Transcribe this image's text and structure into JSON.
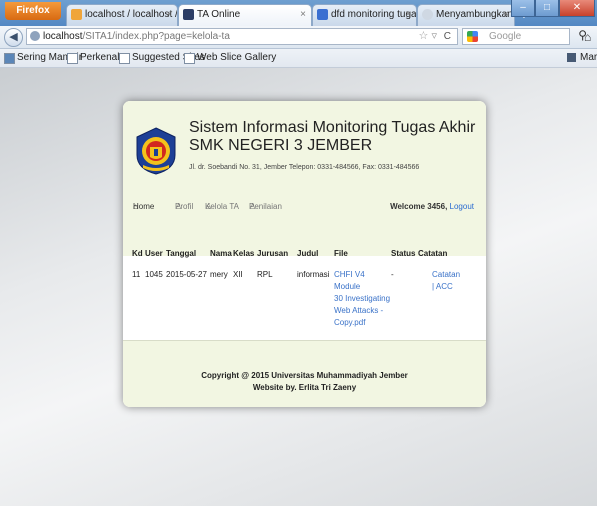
{
  "browser": {
    "firefox_button": "Firefox",
    "tabs": [
      {
        "label": "localhost / localhost / apli..."
      },
      {
        "label": "TA Online"
      },
      {
        "label": "dfd monitoring tugas akhi..."
      },
      {
        "label": "Menyambungkan..."
      }
    ],
    "url_host": "localhost",
    "url_path": "/SITA1/index.php?page=kelola-ta",
    "search_placeholder": "Google",
    "bookmarks": [
      "Sering Mampir",
      "Perkenalan",
      "Suggested Sites",
      "Web Slice Gallery"
    ],
    "bookmarks_right": "Markah"
  },
  "page": {
    "title_line1": "Sistem Informasi Monitoring Tugas Akhir",
    "title_line2": "SMK NEGERI 3 JEMBER",
    "address": "Jl. dr. Soebandi No. 31, Jember Telepon: 0331-484566, Fax: 0331-484566",
    "menu": {
      "home": "Home",
      "profil": "Profil",
      "kelola": "Kelola TA",
      "penilaian": "Penilaian"
    },
    "welcome": "Welcome 3456,",
    "logout": "Logout",
    "table": {
      "headers": [
        "Kd",
        "User",
        "Tanggal",
        "Nama",
        "Kelas",
        "Jurusan",
        "Judul",
        "File",
        "Status",
        "Catatan"
      ],
      "row": {
        "kd": "11",
        "user": "1045",
        "tanggal": "2015-05-27",
        "nama": "mery",
        "kelas": "XII",
        "jurusan": "RPL",
        "judul": "informasi",
        "file_lines": [
          "CHFI V4 Module",
          "30 Investigating",
          "Web Attacks -",
          "Copy.pdf"
        ],
        "status": "-",
        "catatan_lines": [
          "Catatan",
          "| ACC"
        ]
      }
    },
    "footer_line1": "Copyright @ 2015 Universitas Muhammadiyah Jember",
    "footer_line2": "Website by. Erlita Tri Zaeny"
  }
}
